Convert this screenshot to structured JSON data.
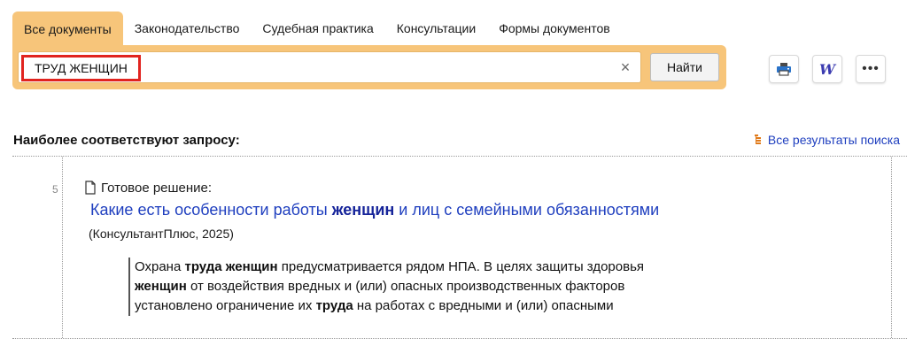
{
  "tabs": [
    {
      "label": "Все документы",
      "active": true
    },
    {
      "label": "Законодательство",
      "active": false
    },
    {
      "label": "Судебная практика",
      "active": false
    },
    {
      "label": "Консультации",
      "active": false
    },
    {
      "label": "Формы документов",
      "active": false
    }
  ],
  "search": {
    "query": "ТРУД ЖЕНЩИН",
    "clear_symbol": "×",
    "button_label": "Найти"
  },
  "toolbar": {
    "word_glyph": "W",
    "more_glyph": "•••"
  },
  "section": {
    "title": "Наиболее соответствуют запросу:",
    "all_results_label": "Все результаты поиска"
  },
  "result": {
    "number": "5",
    "type_label": "Готовое решение:",
    "title_before": "Какие есть особенности работы ",
    "title_bold": "женщин",
    "title_after": " и лиц с семейными обязанностями",
    "source": "(КонсультантПлюс, 2025)",
    "snippet": {
      "l1_a": "Охрана ",
      "l1_b": "труда женщин",
      "l1_c": " предусматривается рядом НПА. В целях защиты здоровья",
      "l2_b": "женщин",
      "l2_c": " от воздействия вредных и (или) опасных производственных факторов",
      "l3_a": "установлено ограничение их ",
      "l3_b": "труда",
      "l3_c": " на работах с вредными и (или) опасными"
    }
  },
  "colors": {
    "tab_active": "#f7c57a",
    "query_highlight_border": "#e1241f",
    "link": "#1f3fbf"
  }
}
